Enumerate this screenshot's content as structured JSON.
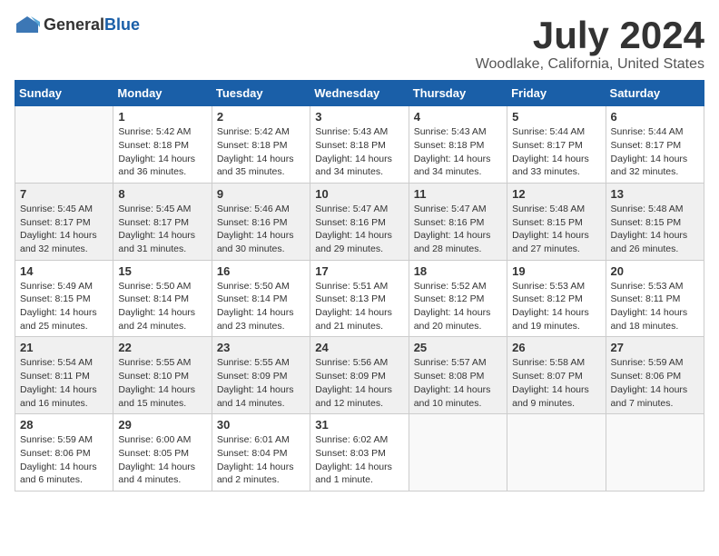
{
  "logo": {
    "text_general": "General",
    "text_blue": "Blue"
  },
  "title": "July 2024",
  "subtitle": "Woodlake, California, United States",
  "weekdays": [
    "Sunday",
    "Monday",
    "Tuesday",
    "Wednesday",
    "Thursday",
    "Friday",
    "Saturday"
  ],
  "weeks": [
    [
      {
        "day": "",
        "sunrise": "",
        "sunset": "",
        "daylight": "",
        "empty": true
      },
      {
        "day": "1",
        "sunrise": "Sunrise: 5:42 AM",
        "sunset": "Sunset: 8:18 PM",
        "daylight": "Daylight: 14 hours and 36 minutes."
      },
      {
        "day": "2",
        "sunrise": "Sunrise: 5:42 AM",
        "sunset": "Sunset: 8:18 PM",
        "daylight": "Daylight: 14 hours and 35 minutes."
      },
      {
        "day": "3",
        "sunrise": "Sunrise: 5:43 AM",
        "sunset": "Sunset: 8:18 PM",
        "daylight": "Daylight: 14 hours and 34 minutes."
      },
      {
        "day": "4",
        "sunrise": "Sunrise: 5:43 AM",
        "sunset": "Sunset: 8:18 PM",
        "daylight": "Daylight: 14 hours and 34 minutes."
      },
      {
        "day": "5",
        "sunrise": "Sunrise: 5:44 AM",
        "sunset": "Sunset: 8:17 PM",
        "daylight": "Daylight: 14 hours and 33 minutes."
      },
      {
        "day": "6",
        "sunrise": "Sunrise: 5:44 AM",
        "sunset": "Sunset: 8:17 PM",
        "daylight": "Daylight: 14 hours and 32 minutes."
      }
    ],
    [
      {
        "day": "7",
        "sunrise": "Sunrise: 5:45 AM",
        "sunset": "Sunset: 8:17 PM",
        "daylight": "Daylight: 14 hours and 32 minutes."
      },
      {
        "day": "8",
        "sunrise": "Sunrise: 5:45 AM",
        "sunset": "Sunset: 8:17 PM",
        "daylight": "Daylight: 14 hours and 31 minutes."
      },
      {
        "day": "9",
        "sunrise": "Sunrise: 5:46 AM",
        "sunset": "Sunset: 8:16 PM",
        "daylight": "Daylight: 14 hours and 30 minutes."
      },
      {
        "day": "10",
        "sunrise": "Sunrise: 5:47 AM",
        "sunset": "Sunset: 8:16 PM",
        "daylight": "Daylight: 14 hours and 29 minutes."
      },
      {
        "day": "11",
        "sunrise": "Sunrise: 5:47 AM",
        "sunset": "Sunset: 8:16 PM",
        "daylight": "Daylight: 14 hours and 28 minutes."
      },
      {
        "day": "12",
        "sunrise": "Sunrise: 5:48 AM",
        "sunset": "Sunset: 8:15 PM",
        "daylight": "Daylight: 14 hours and 27 minutes."
      },
      {
        "day": "13",
        "sunrise": "Sunrise: 5:48 AM",
        "sunset": "Sunset: 8:15 PM",
        "daylight": "Daylight: 14 hours and 26 minutes."
      }
    ],
    [
      {
        "day": "14",
        "sunrise": "Sunrise: 5:49 AM",
        "sunset": "Sunset: 8:15 PM",
        "daylight": "Daylight: 14 hours and 25 minutes."
      },
      {
        "day": "15",
        "sunrise": "Sunrise: 5:50 AM",
        "sunset": "Sunset: 8:14 PM",
        "daylight": "Daylight: 14 hours and 24 minutes."
      },
      {
        "day": "16",
        "sunrise": "Sunrise: 5:50 AM",
        "sunset": "Sunset: 8:14 PM",
        "daylight": "Daylight: 14 hours and 23 minutes."
      },
      {
        "day": "17",
        "sunrise": "Sunrise: 5:51 AM",
        "sunset": "Sunset: 8:13 PM",
        "daylight": "Daylight: 14 hours and 21 minutes."
      },
      {
        "day": "18",
        "sunrise": "Sunrise: 5:52 AM",
        "sunset": "Sunset: 8:12 PM",
        "daylight": "Daylight: 14 hours and 20 minutes."
      },
      {
        "day": "19",
        "sunrise": "Sunrise: 5:53 AM",
        "sunset": "Sunset: 8:12 PM",
        "daylight": "Daylight: 14 hours and 19 minutes."
      },
      {
        "day": "20",
        "sunrise": "Sunrise: 5:53 AM",
        "sunset": "Sunset: 8:11 PM",
        "daylight": "Daylight: 14 hours and 18 minutes."
      }
    ],
    [
      {
        "day": "21",
        "sunrise": "Sunrise: 5:54 AM",
        "sunset": "Sunset: 8:11 PM",
        "daylight": "Daylight: 14 hours and 16 minutes."
      },
      {
        "day": "22",
        "sunrise": "Sunrise: 5:55 AM",
        "sunset": "Sunset: 8:10 PM",
        "daylight": "Daylight: 14 hours and 15 minutes."
      },
      {
        "day": "23",
        "sunrise": "Sunrise: 5:55 AM",
        "sunset": "Sunset: 8:09 PM",
        "daylight": "Daylight: 14 hours and 14 minutes."
      },
      {
        "day": "24",
        "sunrise": "Sunrise: 5:56 AM",
        "sunset": "Sunset: 8:09 PM",
        "daylight": "Daylight: 14 hours and 12 minutes."
      },
      {
        "day": "25",
        "sunrise": "Sunrise: 5:57 AM",
        "sunset": "Sunset: 8:08 PM",
        "daylight": "Daylight: 14 hours and 10 minutes."
      },
      {
        "day": "26",
        "sunrise": "Sunrise: 5:58 AM",
        "sunset": "Sunset: 8:07 PM",
        "daylight": "Daylight: 14 hours and 9 minutes."
      },
      {
        "day": "27",
        "sunrise": "Sunrise: 5:59 AM",
        "sunset": "Sunset: 8:06 PM",
        "daylight": "Daylight: 14 hours and 7 minutes."
      }
    ],
    [
      {
        "day": "28",
        "sunrise": "Sunrise: 5:59 AM",
        "sunset": "Sunset: 8:06 PM",
        "daylight": "Daylight: 14 hours and 6 minutes."
      },
      {
        "day": "29",
        "sunrise": "Sunrise: 6:00 AM",
        "sunset": "Sunset: 8:05 PM",
        "daylight": "Daylight: 14 hours and 4 minutes."
      },
      {
        "day": "30",
        "sunrise": "Sunrise: 6:01 AM",
        "sunset": "Sunset: 8:04 PM",
        "daylight": "Daylight: 14 hours and 2 minutes."
      },
      {
        "day": "31",
        "sunrise": "Sunrise: 6:02 AM",
        "sunset": "Sunset: 8:03 PM",
        "daylight": "Daylight: 14 hours and 1 minute."
      },
      {
        "day": "",
        "sunrise": "",
        "sunset": "",
        "daylight": "",
        "empty": true
      },
      {
        "day": "",
        "sunrise": "",
        "sunset": "",
        "daylight": "",
        "empty": true
      },
      {
        "day": "",
        "sunrise": "",
        "sunset": "",
        "daylight": "",
        "empty": true
      }
    ]
  ]
}
